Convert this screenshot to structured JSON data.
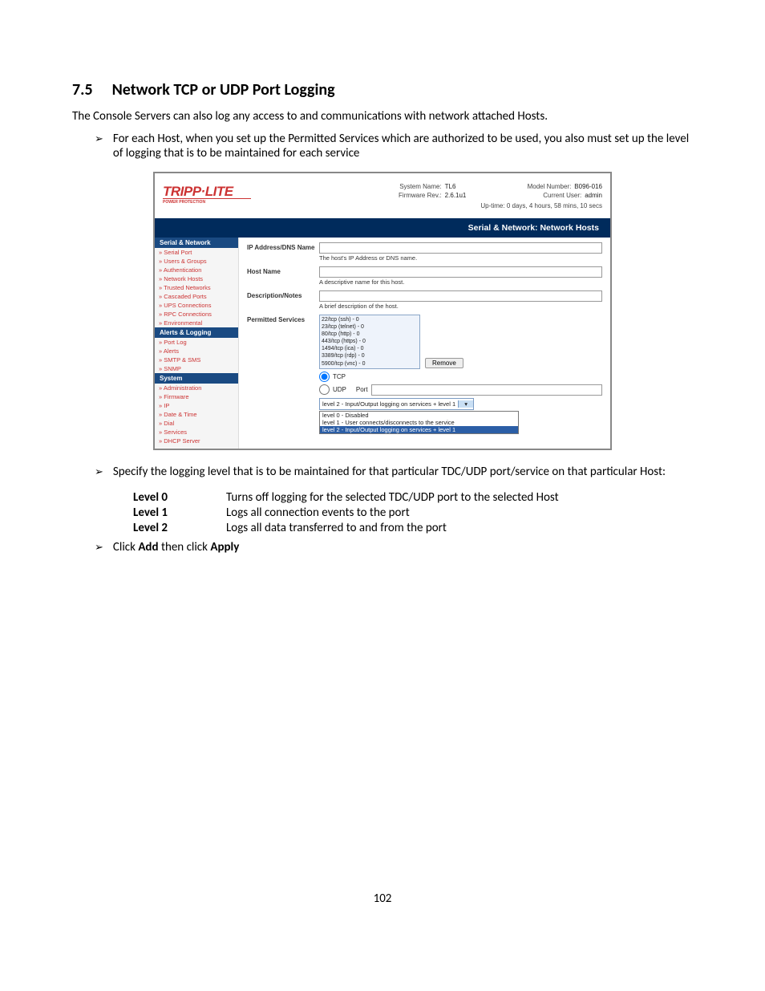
{
  "heading": {
    "num": "7.5",
    "title": "Network TCP or UDP Port Logging"
  },
  "intro": "The Console Servers can also log any access to and communications with network attached Hosts.",
  "bullets": {
    "b1": "For each Host, when you set up the Permitted Services which are authorized to be used, you also must set up the level of logging that is to be maintained for each service",
    "b2": "Specify the logging level that is to be maintained for that particular TDC/UDP port/service on that particular Host:",
    "b3_pre": "Click ",
    "b3_a": "Add",
    "b3_mid": " then click ",
    "b3_b": "Apply"
  },
  "levels": {
    "l0_label": "Level 0",
    "l0_desc": "Turns off logging for the selected TDC/UDP port to the selected Host",
    "l1_label": "Level 1",
    "l1_desc": "Logs all connection events to the port",
    "l2_label": "Level 2",
    "l2_desc": "Logs all data transferred to and from the port"
  },
  "page_num": "102",
  "figure": {
    "logo": "TRIPP·LITE",
    "logo_sub": "POWER PROTECTION",
    "header": {
      "sys_name_l": "System Name:",
      "sys_name_v": "TL6",
      "fw_l": "Firmware Rev.:",
      "fw_v": "2.6.1u1",
      "model_l": "Model Number:",
      "model_v": "B096-016",
      "user_l": "Current User:",
      "user_v": "admin",
      "uptime": "Up-time: 0 days, 4 hours, 58 mins, 10 secs"
    },
    "title_bar": "Serial & Network: Network Hosts",
    "sidebar": {
      "g1": "Serial & Network",
      "g1_items": [
        "Serial Port",
        "Users & Groups",
        "Authentication",
        "Network Hosts",
        "Trusted Networks",
        "Cascaded Ports",
        "UPS Connections",
        "RPC Connections",
        "Environmental"
      ],
      "g2": "Alerts & Logging",
      "g2_items": [
        "Port Log",
        "Alerts",
        "SMTP & SMS",
        "SNMP"
      ],
      "g3": "System",
      "g3_items": [
        "Administration",
        "Firmware",
        "IP",
        "Date & Time",
        "Dial",
        "Services",
        "DHCP Server"
      ]
    },
    "fields": {
      "ip_label": "IP Address/DNS Name",
      "ip_help": "The host's IP Address or DNS name.",
      "hn_label": "Host Name",
      "hn_help": "A descriptive name for this host.",
      "dn_label": "Description/Notes",
      "dn_help": "A brief description of the host.",
      "ps_label": "Permitted Services"
    },
    "services": [
      "22/tcp (ssh) - 0",
      "23/tcp (telnet) - 0",
      "80/tcp (http) - 0",
      "443/tcp (https) - 0",
      "1494/tcp (ica) - 0",
      "3389/tcp (rdp) - 0",
      "5900/tcp (vnc) - 0"
    ],
    "remove": "Remove",
    "protocol": {
      "tcp": "TCP",
      "udp": "UDP",
      "port": "Port"
    },
    "level_selected": "level 2 - Input/Output logging on services + level 1",
    "level_options": [
      "level 0 - Disabled",
      "level 1 - User connects/disconnects to the service",
      "level 2 - Input/Output logging on services + level 1"
    ]
  }
}
